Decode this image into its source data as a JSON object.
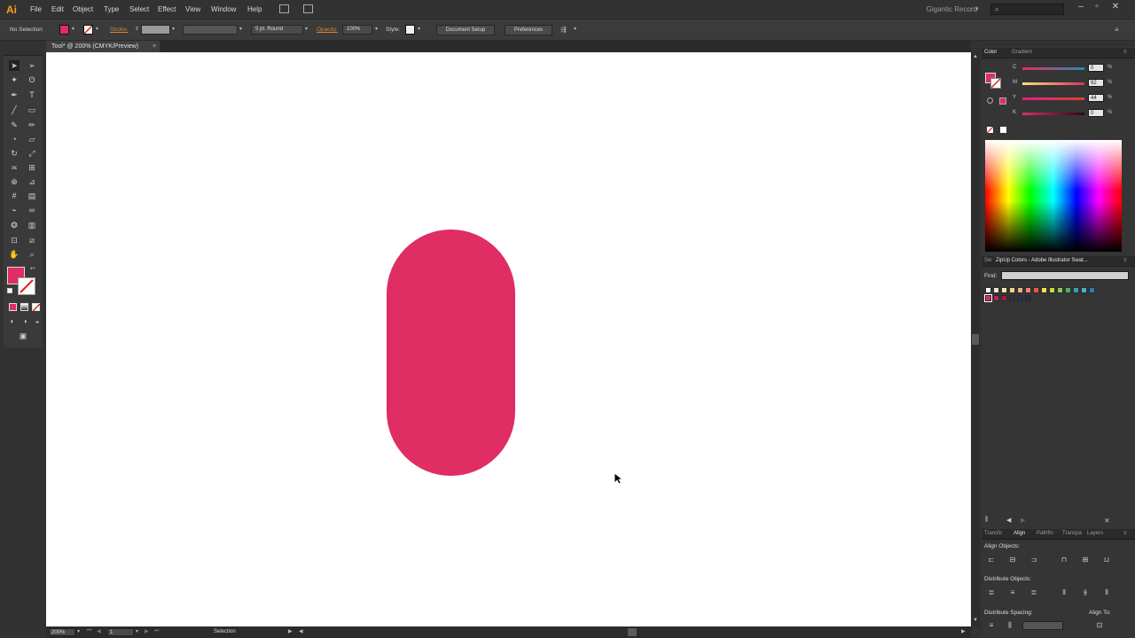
{
  "app": {
    "logo": "Ai",
    "workspace": "Gigantic Record"
  },
  "menu": [
    "File",
    "Edit",
    "Object",
    "Type",
    "Select",
    "Effect",
    "View",
    "Window",
    "Help"
  ],
  "control_bar": {
    "selection_status": "No Selection",
    "stroke_label": "Stroke:",
    "brush_value": "5 pt. Round",
    "opacity_label": "Opacity:",
    "opacity_value": "100%",
    "style_label": "Style:",
    "document_setup": "Document Setup",
    "preferences": "Preferences"
  },
  "document_tab": {
    "title": "Tool* @ 200% (CMYK/Preview)",
    "close": "×"
  },
  "status_bar": {
    "zoom": "200%",
    "artboard": "1",
    "tool": "Selection"
  },
  "colors": {
    "fill": "#e02d63",
    "canvas": "#ffffff"
  },
  "color_panel": {
    "tabs": [
      "Color",
      "Gradient"
    ],
    "channels": [
      {
        "label": "C",
        "value": "0",
        "pct": "%"
      },
      {
        "label": "M",
        "value": "92",
        "pct": "%"
      },
      {
        "label": "Y",
        "value": "44",
        "pct": "%"
      },
      {
        "label": "K",
        "value": "0",
        "pct": "%"
      }
    ]
  },
  "swatches_panel": {
    "tabs": [
      "Sw",
      "ZipUp Colors - Adobe Illustrator Swat..."
    ],
    "find_label": "Find:",
    "swatch_colors": [
      "#ffffff",
      "#f0e6d0",
      "#f5e6b0",
      "#f5d08a",
      "#f2b08a",
      "#f08070",
      "#e85a4a",
      "#f5e14a",
      "#c8d84a",
      "#8cc84a",
      "#4ab070",
      "#3aa0b0",
      "#4ab0d0",
      "#2a7ab0",
      "#e02d63",
      "#c02050",
      "#a01a40",
      "#303040",
      "#2a3050",
      "#203048"
    ]
  },
  "bottom_panel": {
    "tabs": [
      "Transfo",
      "Align",
      "Pathfin",
      "Transpa",
      "Layers"
    ],
    "align_objects": "Align Objects:",
    "distribute_objects": "Distribute Objects:",
    "distribute_spacing": "Distribute Spacing:",
    "align_to": "Align To:"
  }
}
